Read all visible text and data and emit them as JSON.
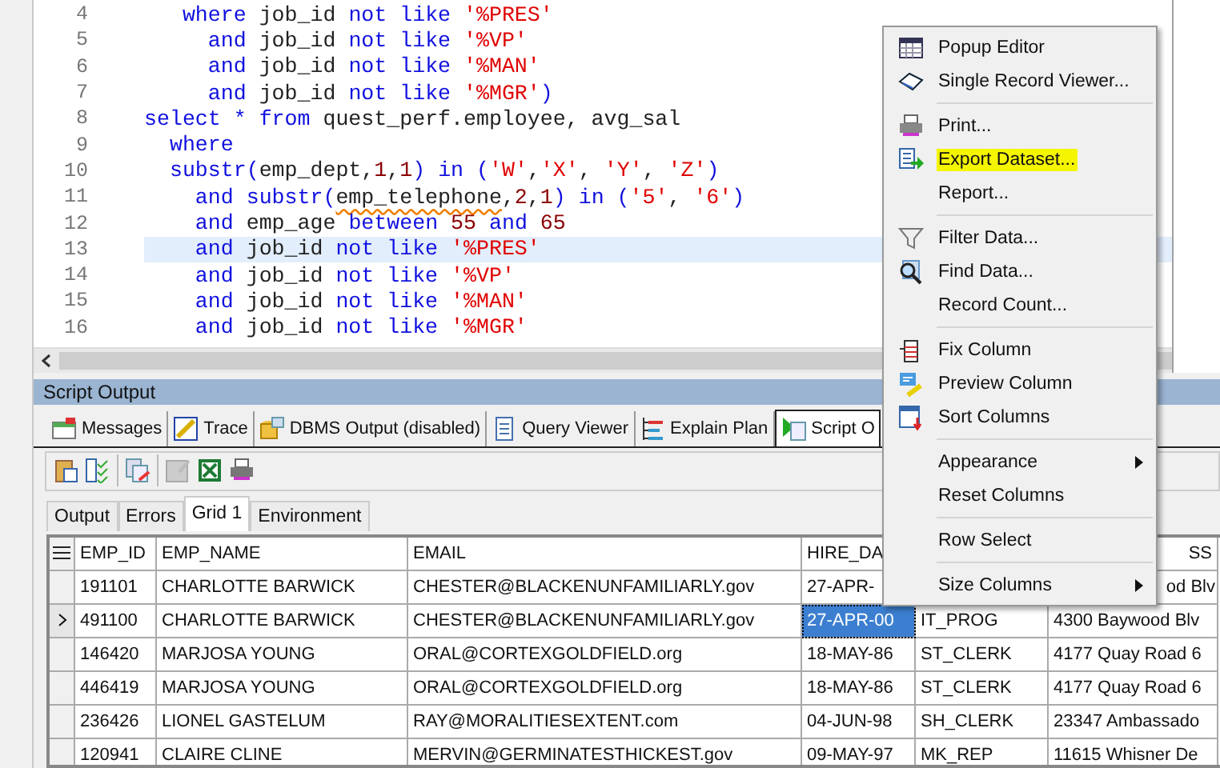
{
  "editor": {
    "lines": [
      {
        "number": "4",
        "current": false,
        "tokens": [
          {
            "kind": "kw",
            "text": "   where"
          },
          {
            "kind": "id",
            "text": " job_id "
          },
          {
            "kind": "kw",
            "text": "not like "
          },
          {
            "kind": "str",
            "text": "'%PRES'"
          }
        ]
      },
      {
        "number": "5",
        "current": false,
        "tokens": [
          {
            "kind": "kw",
            "text": "     and"
          },
          {
            "kind": "id",
            "text": " job_id "
          },
          {
            "kind": "kw",
            "text": "not like "
          },
          {
            "kind": "str",
            "text": "'%VP'"
          }
        ]
      },
      {
        "number": "6",
        "current": false,
        "tokens": [
          {
            "kind": "kw",
            "text": "     and"
          },
          {
            "kind": "id",
            "text": " job_id "
          },
          {
            "kind": "kw",
            "text": "not like "
          },
          {
            "kind": "str",
            "text": "'%MAN'"
          }
        ]
      },
      {
        "number": "7",
        "current": false,
        "tokens": [
          {
            "kind": "kw",
            "text": "     and"
          },
          {
            "kind": "id",
            "text": " job_id "
          },
          {
            "kind": "kw",
            "text": "not like "
          },
          {
            "kind": "str",
            "text": "'%MGR'"
          },
          {
            "kind": "kw",
            "text": ")"
          }
        ]
      },
      {
        "number": "8",
        "current": false,
        "tokens": [
          {
            "kind": "kw",
            "text": "select * from"
          },
          {
            "kind": "id",
            "text": " quest_perf.employee, avg_sal"
          }
        ]
      },
      {
        "number": "9",
        "current": false,
        "tokens": [
          {
            "kind": "kw",
            "text": "  where"
          }
        ]
      },
      {
        "number": "10",
        "current": false,
        "tokens": [
          {
            "kind": "kw",
            "text": "  substr("
          },
          {
            "kind": "id",
            "text": "emp_dept,"
          },
          {
            "kind": "num",
            "text": "1"
          },
          {
            "kind": "id",
            "text": ","
          },
          {
            "kind": "num",
            "text": "1"
          },
          {
            "kind": "kw",
            "text": ") in ("
          },
          {
            "kind": "str",
            "text": "'W'"
          },
          {
            "kind": "id",
            "text": ","
          },
          {
            "kind": "str",
            "text": "'X'"
          },
          {
            "kind": "id",
            "text": ", "
          },
          {
            "kind": "str",
            "text": "'Y'"
          },
          {
            "kind": "id",
            "text": ", "
          },
          {
            "kind": "str",
            "text": "'Z'"
          },
          {
            "kind": "kw",
            "text": ")"
          }
        ]
      },
      {
        "number": "11",
        "current": false,
        "tokens": [
          {
            "kind": "kw",
            "text": "    and substr("
          },
          {
            "kind": "err",
            "text": "emp_telephone"
          },
          {
            "kind": "id",
            "text": ","
          },
          {
            "kind": "num",
            "text": "2"
          },
          {
            "kind": "id",
            "text": ","
          },
          {
            "kind": "num",
            "text": "1"
          },
          {
            "kind": "kw",
            "text": ") in ("
          },
          {
            "kind": "str",
            "text": "'5'"
          },
          {
            "kind": "id",
            "text": ", "
          },
          {
            "kind": "str",
            "text": "'6'"
          },
          {
            "kind": "kw",
            "text": ")"
          }
        ]
      },
      {
        "number": "12",
        "current": false,
        "tokens": [
          {
            "kind": "kw",
            "text": "    and"
          },
          {
            "kind": "id",
            "text": " emp_age "
          },
          {
            "kind": "kw",
            "text": "between "
          },
          {
            "kind": "num",
            "text": "55"
          },
          {
            "kind": "kw",
            "text": " and "
          },
          {
            "kind": "num",
            "text": "65"
          }
        ]
      },
      {
        "number": "13",
        "current": true,
        "tokens": [
          {
            "kind": "kw",
            "text": "    and"
          },
          {
            "kind": "id",
            "text": " job_id "
          },
          {
            "kind": "kw",
            "text": "not like "
          },
          {
            "kind": "str",
            "text": "'%PRES'"
          }
        ]
      },
      {
        "number": "14",
        "current": false,
        "tokens": [
          {
            "kind": "kw",
            "text": "    and"
          },
          {
            "kind": "id",
            "text": " job_id "
          },
          {
            "kind": "kw",
            "text": "not like "
          },
          {
            "kind": "str",
            "text": "'%VP'"
          }
        ]
      },
      {
        "number": "15",
        "current": false,
        "tokens": [
          {
            "kind": "kw",
            "text": "    and"
          },
          {
            "kind": "id",
            "text": " job_id "
          },
          {
            "kind": "kw",
            "text": "not like "
          },
          {
            "kind": "str",
            "text": "'%MAN'"
          }
        ]
      },
      {
        "number": "16",
        "current": false,
        "tokens": [
          {
            "kind": "kw",
            "text": "    and"
          },
          {
            "kind": "id",
            "text": " job_id "
          },
          {
            "kind": "kw",
            "text": "not like "
          },
          {
            "kind": "str",
            "text": "'%MGR'"
          }
        ]
      }
    ]
  },
  "output_panel": {
    "title": "Script Output",
    "tabs": [
      {
        "label": "Messages",
        "selected": false
      },
      {
        "label": "Trace",
        "selected": false
      },
      {
        "label": "DBMS Output (disabled)",
        "selected": false
      },
      {
        "label": "Query Viewer",
        "selected": false
      },
      {
        "label": "Explain Plan",
        "selected": false
      },
      {
        "label": "Script O",
        "selected": true
      }
    ],
    "sub_tabs": [
      {
        "label": "Output",
        "selected": false
      },
      {
        "label": "Errors",
        "selected": false
      },
      {
        "label": "Grid 1",
        "selected": true
      },
      {
        "label": "Environment",
        "selected": false
      }
    ]
  },
  "grid": {
    "columns": [
      {
        "label": "EMP_ID"
      },
      {
        "label": "EMP_NAME"
      },
      {
        "label": "EMAIL"
      },
      {
        "label": "HIRE_DA"
      },
      null,
      {
        "label": "SS",
        "cut_left": true
      }
    ],
    "rows": [
      {
        "current": false,
        "cells": [
          {
            "text": "191101",
            "selected": false
          },
          {
            "text": "CHARLOTTE BARWICK",
            "selected": false
          },
          {
            "text": "CHESTER@BLACKENUNFAMILIARLY.gov",
            "selected": false
          },
          {
            "text": "27-APR-",
            "selected": false
          },
          null,
          {
            "text": "od Blv",
            "selected": false,
            "cut_left": true
          }
        ]
      },
      {
        "current": true,
        "cells": [
          {
            "text": "491100",
            "selected": false
          },
          {
            "text": "CHARLOTTE BARWICK",
            "selected": false
          },
          {
            "text": "CHESTER@BLACKENUNFAMILIARLY.gov",
            "selected": false
          },
          {
            "text": "27-APR-00",
            "selected": true
          },
          {
            "text": "IT_PROG",
            "selected": false
          },
          {
            "text": "4300 Baywood Blv",
            "selected": false
          }
        ]
      },
      {
        "current": false,
        "cells": [
          {
            "text": "146420",
            "selected": false
          },
          {
            "text": "MARJOSA YOUNG",
            "selected": false
          },
          {
            "text": "ORAL@CORTEXGOLDFIELD.org",
            "selected": false
          },
          {
            "text": "18-MAY-86",
            "selected": false
          },
          {
            "text": "ST_CLERK",
            "selected": false
          },
          {
            "text": "4177 Quay Road 6",
            "selected": false
          }
        ]
      },
      {
        "current": false,
        "cells": [
          {
            "text": "446419",
            "selected": false
          },
          {
            "text": "MARJOSA YOUNG",
            "selected": false
          },
          {
            "text": "ORAL@CORTEXGOLDFIELD.org",
            "selected": false
          },
          {
            "text": "18-MAY-86",
            "selected": false
          },
          {
            "text": "ST_CLERK",
            "selected": false
          },
          {
            "text": "4177 Quay Road 6",
            "selected": false
          }
        ]
      },
      {
        "current": false,
        "cells": [
          {
            "text": "236426",
            "selected": false
          },
          {
            "text": "LIONEL GASTELUM",
            "selected": false
          },
          {
            "text": "RAY@MORALITIESEXTENT.com",
            "selected": false
          },
          {
            "text": "04-JUN-98",
            "selected": false
          },
          {
            "text": "SH_CLERK",
            "selected": false
          },
          {
            "text": "23347 Ambassado",
            "selected": false
          }
        ]
      },
      {
        "current": false,
        "cells": [
          {
            "text": "120941",
            "selected": false
          },
          {
            "text": "CLAIRE CLINE",
            "selected": false
          },
          {
            "text": "MERVIN@GERMINATESTHICKEST.gov",
            "selected": false
          },
          {
            "text": "09-MAY-97",
            "selected": false
          },
          {
            "text": "MK_REP",
            "selected": false
          },
          {
            "text": "11615 Whisner De",
            "selected": false
          }
        ]
      }
    ]
  },
  "context_menu": {
    "groups": [
      [
        {
          "label": "Popup Editor",
          "highlighted": false,
          "submenu": false
        },
        {
          "label": "Single Record Viewer...",
          "highlighted": false,
          "submenu": false
        }
      ],
      [
        {
          "label": "Print...",
          "highlighted": false,
          "submenu": false
        },
        {
          "label": "Export Dataset...",
          "highlighted": true,
          "submenu": false
        },
        {
          "label": "Report...",
          "highlighted": false,
          "submenu": false
        }
      ],
      [
        {
          "label": "Filter Data...",
          "highlighted": false,
          "submenu": false
        },
        {
          "label": "Find Data...",
          "highlighted": false,
          "submenu": false
        },
        {
          "label": "Record Count...",
          "highlighted": false,
          "submenu": false
        }
      ],
      [
        {
          "label": "Fix Column",
          "highlighted": false,
          "submenu": false
        },
        {
          "label": "Preview Column",
          "highlighted": false,
          "submenu": false
        },
        {
          "label": "Sort Columns",
          "highlighted": false,
          "submenu": false
        }
      ],
      [
        {
          "label": "Appearance",
          "highlighted": false,
          "submenu": true
        },
        {
          "label": "Reset Columns",
          "highlighted": false,
          "submenu": false
        }
      ],
      [
        {
          "label": "Row Select",
          "highlighted": false,
          "submenu": false
        }
      ],
      [
        {
          "label": "Size Columns",
          "highlighted": false,
          "submenu": true
        }
      ]
    ]
  }
}
